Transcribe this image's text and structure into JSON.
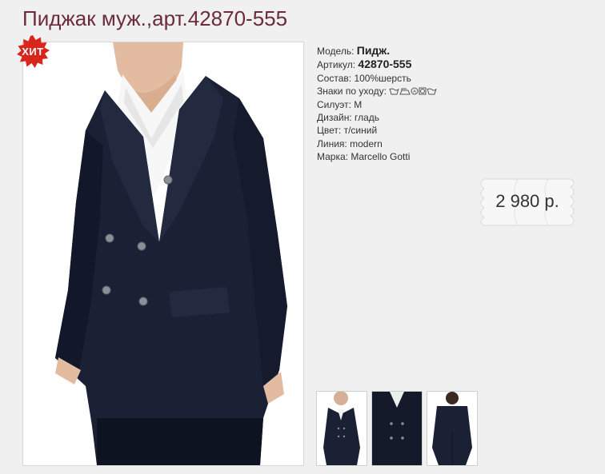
{
  "page": {
    "title": "Пиджак муж.,арт.42870-555"
  },
  "badge": {
    "label": "ХИТ",
    "color": "#d9261c"
  },
  "product": {
    "props": [
      {
        "label": "Модель:",
        "value": "Пидж.",
        "strong": true
      },
      {
        "label": "Артикул:",
        "value": "42870-555",
        "strong": true
      },
      {
        "label": "Состав:",
        "value": "100%шерсть"
      },
      {
        "label": "Знаки по уходу:",
        "icons": [
          "wash-icon",
          "iron-icon",
          "dry-clean-icon",
          "no-tumble-dry-icon",
          "wash-icon"
        ]
      },
      {
        "label": "Силуэт:",
        "value": "М"
      },
      {
        "label": "Дизайн:",
        "value": "гладь"
      },
      {
        "label": "Цвет:",
        "value": "т/синий"
      },
      {
        "label": "Линия:",
        "value": "modern"
      },
      {
        "label": "Марка:",
        "value": "Marcello Gotti"
      }
    ]
  },
  "price": {
    "text": "2 980 р."
  },
  "thumbnails": [
    {
      "view": "front-angled"
    },
    {
      "view": "front-close"
    },
    {
      "view": "back"
    }
  ],
  "colors": {
    "title": "#6b2c3a",
    "jacket": "#1a2033",
    "badge": "#d9261c"
  }
}
